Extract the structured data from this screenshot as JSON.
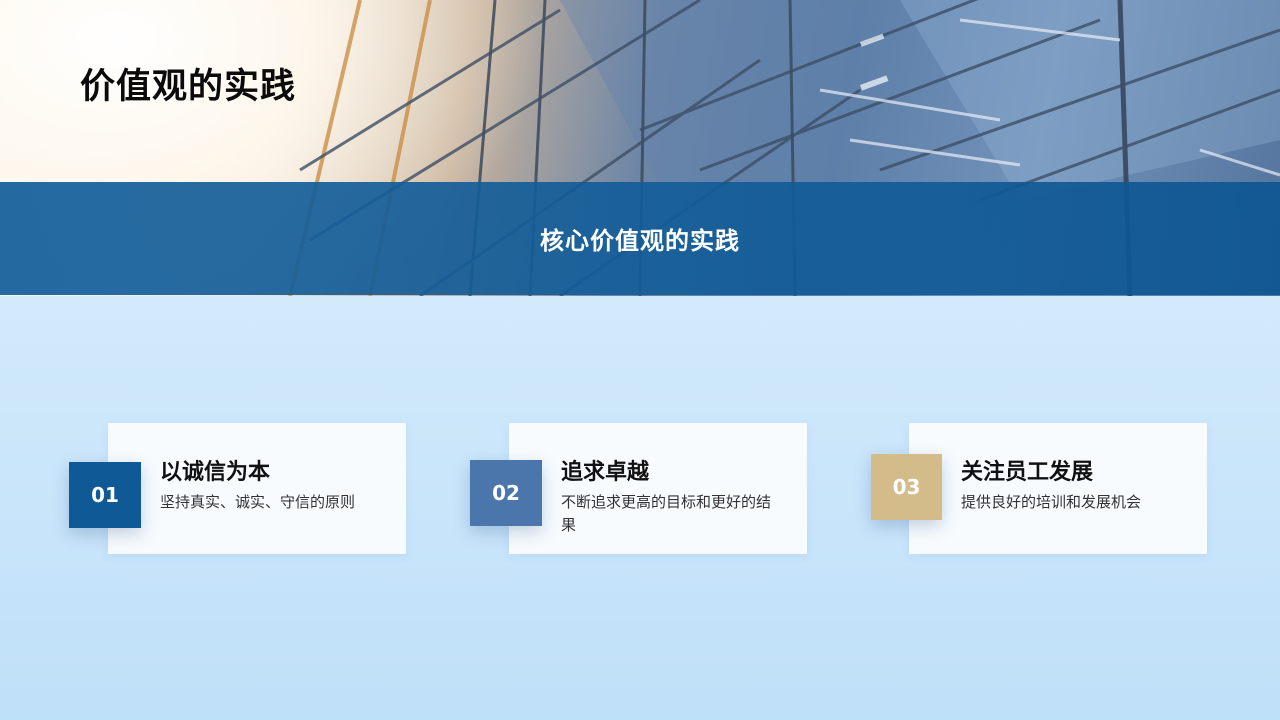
{
  "header": {
    "title": "价值观的实践"
  },
  "band": {
    "title": "核心价值观的实践"
  },
  "items": [
    {
      "number": "01",
      "title": "以诚信为本",
      "description": "坚持真实、诚实、守信的原则",
      "color": "#0e5996"
    },
    {
      "number": "02",
      "title": "追求卓越",
      "description": "不断追求更高的目标和更好的结果",
      "color": "#4a76ab"
    },
    {
      "number": "03",
      "title": "关注员工发展",
      "description": "提供良好的培训和发展机会",
      "color": "#d4bb8a"
    }
  ],
  "colors": {
    "band": "#145f9b",
    "background": "#d6ecfc"
  }
}
